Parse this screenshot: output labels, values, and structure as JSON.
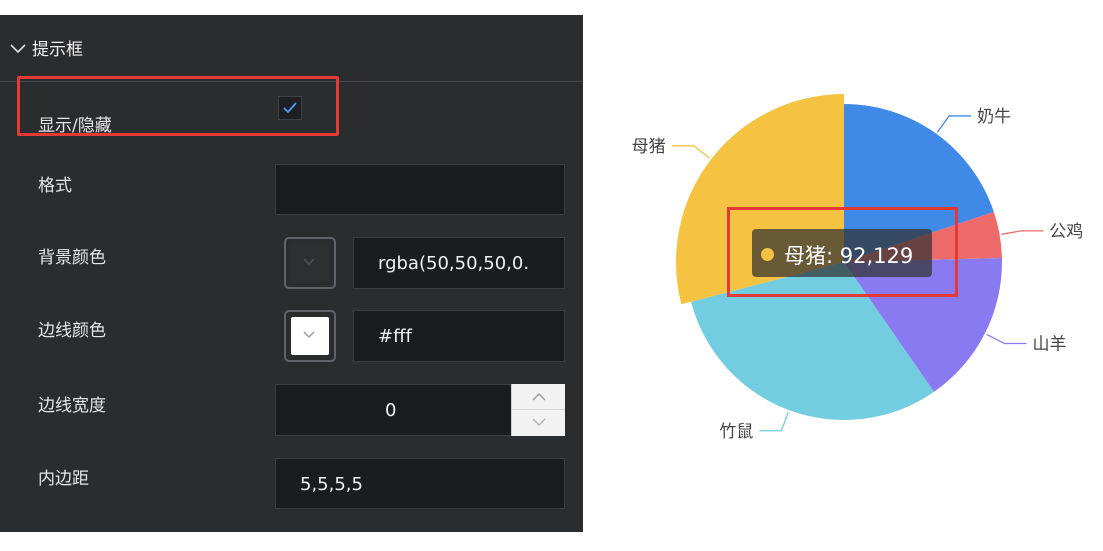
{
  "panel": {
    "section_title": "提示框",
    "rows": {
      "visibility_label": "显示/隐藏",
      "visibility_checked": true,
      "format_label": "格式",
      "format_value": "",
      "bg_color_label": "背景颜色",
      "bg_color_value": "rgba(50,50,50,0.",
      "border_color_label": "边线颜色",
      "border_color_value": "#fff",
      "border_width_label": "边线宽度",
      "border_width_value": "0",
      "padding_label": "内边距",
      "padding_value": "5,5,5,5"
    },
    "colors": {
      "panel_bg": "#2b2c2e",
      "highlight": "#e53935",
      "check": "#4a9eff"
    }
  },
  "tooltip": {
    "text": "母猪: 92,129",
    "dot_color": "#f5c242"
  },
  "chart_data": {
    "type": "pie",
    "title": "",
    "series": [
      {
        "name": "奶牛",
        "value": 63000,
        "color": "#3e8ae6"
      },
      {
        "name": "公鸡",
        "value": 15000,
        "color": "#ee6b6b"
      },
      {
        "name": "山羊",
        "value": 50000,
        "color": "#8a7af2"
      },
      {
        "name": "竹鼠",
        "value": 97000,
        "color": "#72cde0"
      },
      {
        "name": "母猪",
        "value": 92129,
        "color": "#f5c242"
      }
    ],
    "start_angle": "12 o'clock, clockwise",
    "highlighted_slice": "母猪"
  }
}
